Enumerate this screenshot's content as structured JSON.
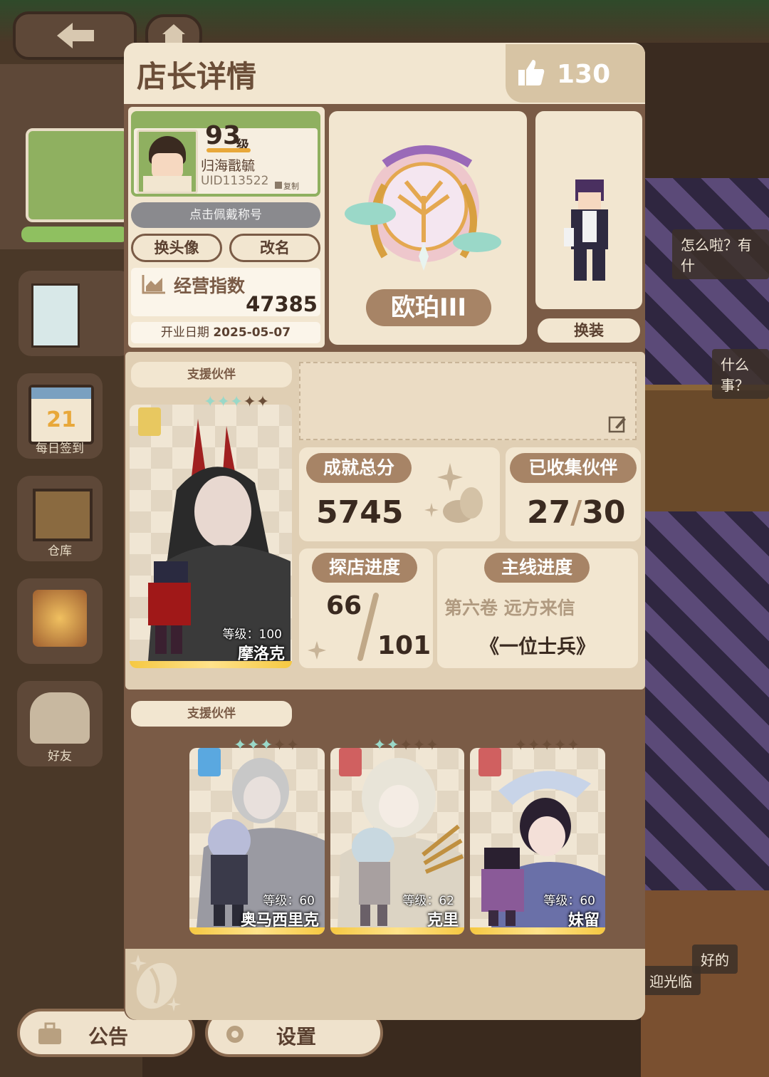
{
  "panel": {
    "title": "店长详情",
    "likes": "130"
  },
  "profile": {
    "level_num": "93",
    "level_unit": "级",
    "name": "归海戬毓",
    "uid": "UID113522",
    "copy_label": "复制",
    "title_hint": "点击佩戴称号",
    "change_avatar": "换头像",
    "rename": "改名",
    "biz_label": "经营指数",
    "biz_value": "47385",
    "open_label": "开业日期",
    "open_date": "2025-05-07"
  },
  "rank": {
    "name": "欧珀III"
  },
  "outfit": {
    "button": "换装"
  },
  "support": {
    "label": "支援伙伴",
    "main": {
      "level_label": "等级：100",
      "name": "摩洛克",
      "stars_lit": 3,
      "stars_total": 5
    }
  },
  "stats": {
    "achievement_label": "成就总分",
    "achievement_value": "5745",
    "collected_label": "已收集伙伴",
    "collected_value": "27",
    "collected_total": "30",
    "explore_label": "探店进度",
    "explore_value": "66",
    "explore_total": "101",
    "story_label": "主线进度",
    "story_volume": "第六卷 远方来信",
    "story_chapter": "《一位士兵》"
  },
  "support2": {
    "label": "支援伙伴",
    "partners": [
      {
        "level_label": "等级：60",
        "name": "奥马西里克",
        "stars_lit": 3,
        "stars_total": 5,
        "role_color": "#5aa8e0"
      },
      {
        "level_label": "等级：62",
        "name": "克里",
        "stars_lit": 2,
        "stars_total": 5,
        "role_color": "#d06060"
      },
      {
        "level_label": "等级：60",
        "name": "妹留",
        "stars_lit": 0,
        "stars_total": 5,
        "role_color": "#d06060"
      }
    ]
  },
  "bottom": {
    "notice": "公告",
    "settings": "设置"
  },
  "left_menu": {
    "checkin": "每日签到",
    "storage": "仓库",
    "friends": "好友",
    "calendar_day": "21"
  },
  "scene_bubbles": {
    "b1": "怎么啦？有什",
    "b2": "什么事？",
    "b3": "好的",
    "b4": "迎光临"
  }
}
